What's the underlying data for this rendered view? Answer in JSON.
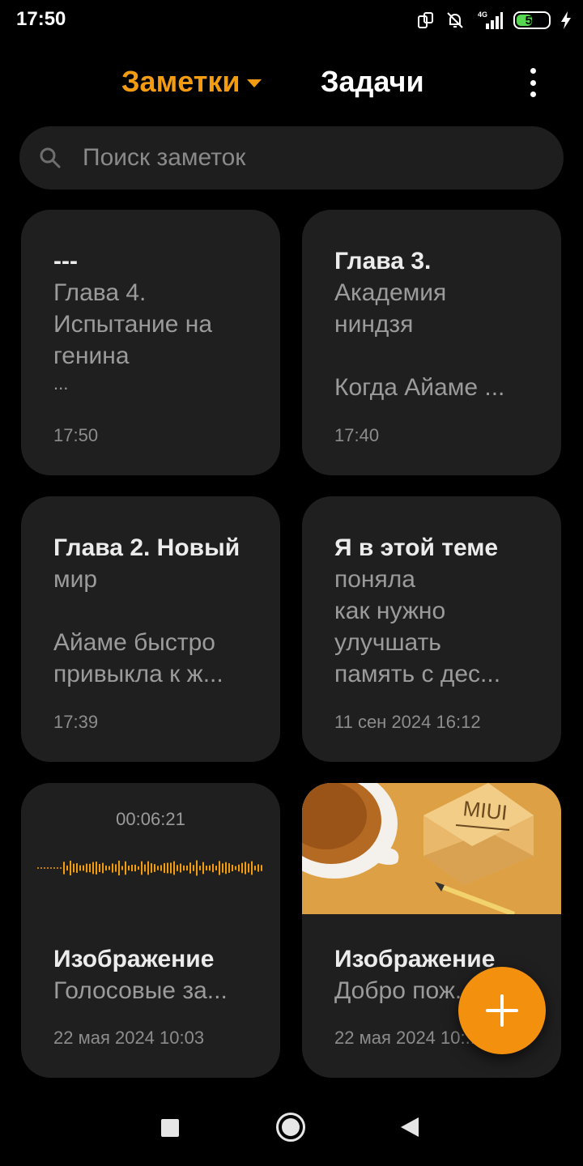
{
  "status_bar": {
    "time": "17:50",
    "network": "4G",
    "battery": 51,
    "battery_label": "51",
    "icons": [
      "screen-rotate-icon",
      "bell-off-icon",
      "signal-icon",
      "battery-icon",
      "charging-bolt-icon"
    ]
  },
  "header": {
    "notes_tab": "Заметки",
    "tasks_tab": "Задачи",
    "more_icon": "vertical-dots-icon"
  },
  "search": {
    "placeholder": "Поиск заметок",
    "icon": "search-icon"
  },
  "notes": [
    {
      "title": "---",
      "lines": [
        "Глава 4.",
        "Испытание на",
        "генина",
        "..."
      ],
      "date": "17:50"
    },
    {
      "title": "Глава 3.",
      "lines": [
        "Академия",
        "ниндзя",
        "",
        "Когда Айаме ..."
      ],
      "date": "17:40"
    },
    {
      "title": "Глава 2. Новый",
      "lines": [
        "мир",
        "",
        "Айаме быстро",
        "привыкла к ж..."
      ],
      "date": "17:39"
    },
    {
      "title": "Я в этой теме",
      "lines": [
        "поняла",
        "как нужно",
        "улучшать",
        "память с дес..."
      ],
      "date": "11 сен 2024 16:12"
    },
    {
      "duration": "00:06:21",
      "title": "Изображение",
      "lines": [
        "Голосовые за..."
      ],
      "date": "22 мая 2024 10:03",
      "attachment": "waveform"
    },
    {
      "image_text": "MIUI",
      "title": "Изображение",
      "lines": [
        "Добро пож..."
      ],
      "date": "22 мая 2024 10:...",
      "attachment": "image"
    }
  ],
  "fab": {
    "icon": "plus-icon"
  },
  "colors": {
    "accent": "#f39c12",
    "fab": "#f3910f",
    "card_bg": "#1f1f1f",
    "search_bg": "#1e1e1e",
    "background": "#000000"
  },
  "nav": {
    "icons": [
      "recents-square-icon",
      "home-circle-icon",
      "back-triangle-icon"
    ]
  }
}
